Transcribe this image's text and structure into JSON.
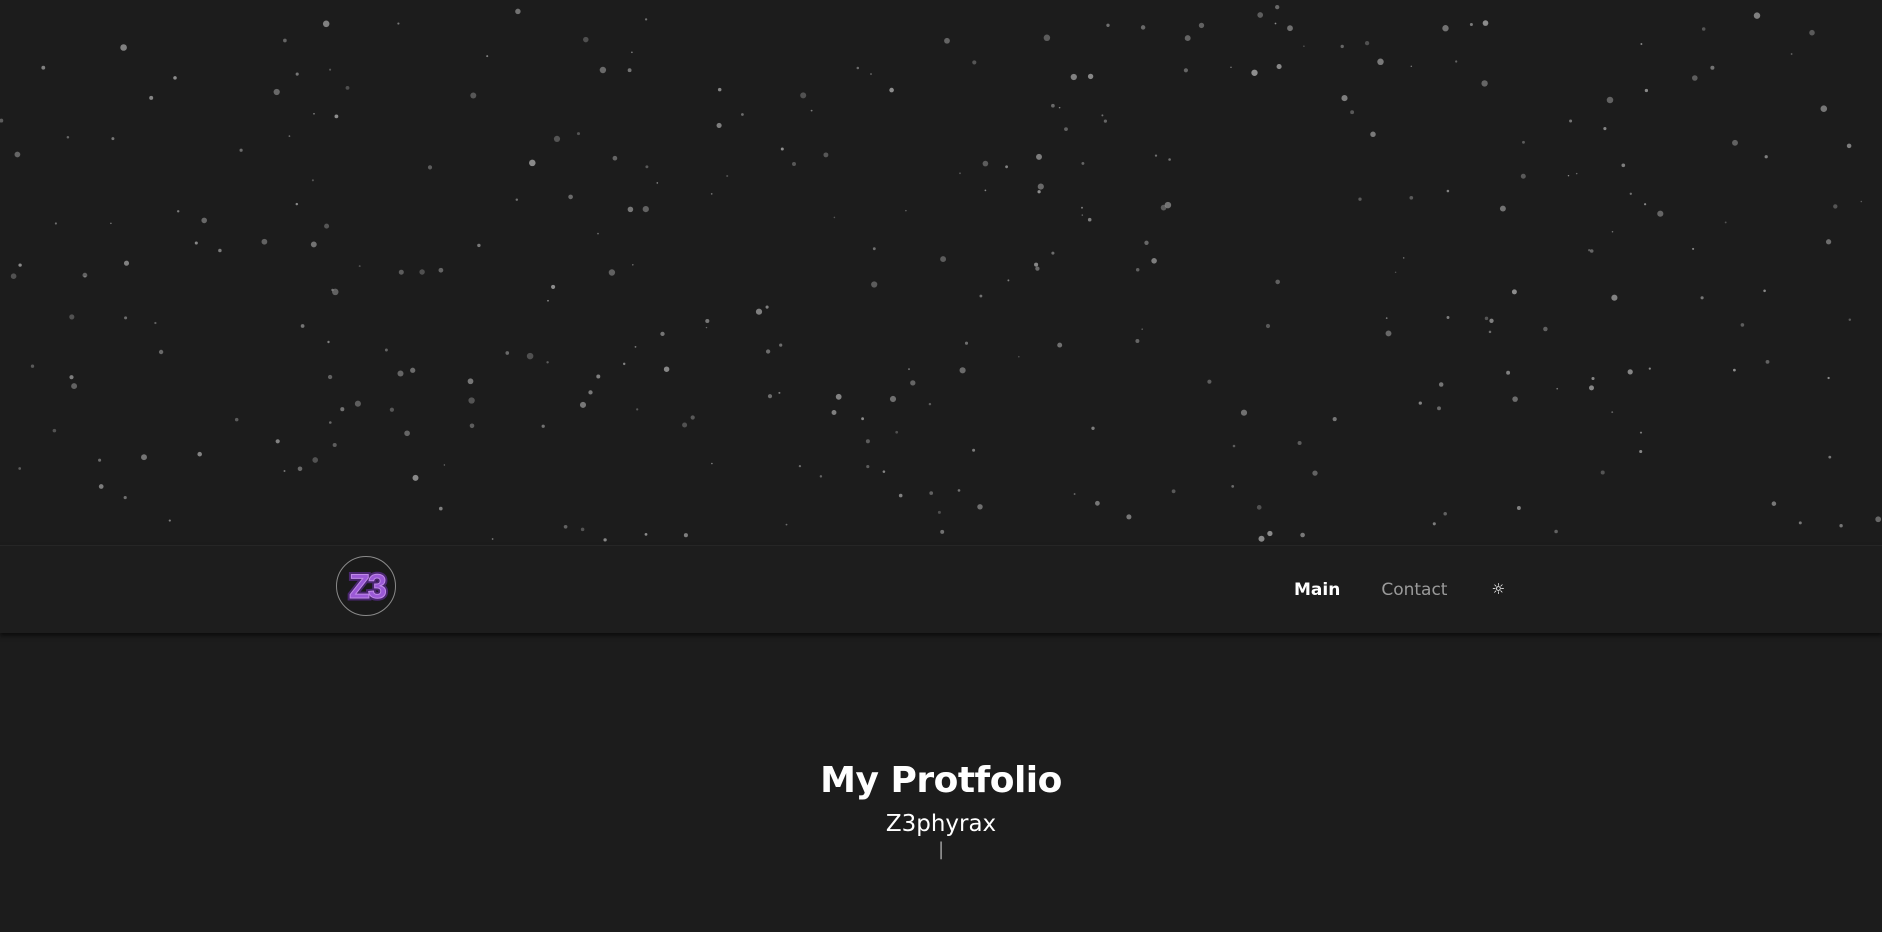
{
  "background": {
    "page_color": "#1c1c1c",
    "star_color": "#8e8e8e"
  },
  "header": {
    "logo_text": "Z3",
    "logo_color": "#9b59d6",
    "nav": [
      {
        "label": "Main",
        "active": true
      },
      {
        "label": "Contact",
        "active": false
      }
    ],
    "theme_toggle_glyph": "☼"
  },
  "hero": {
    "title": "My Protfolio",
    "subtitle": "Z3phyrax",
    "typing_text": "|"
  }
}
